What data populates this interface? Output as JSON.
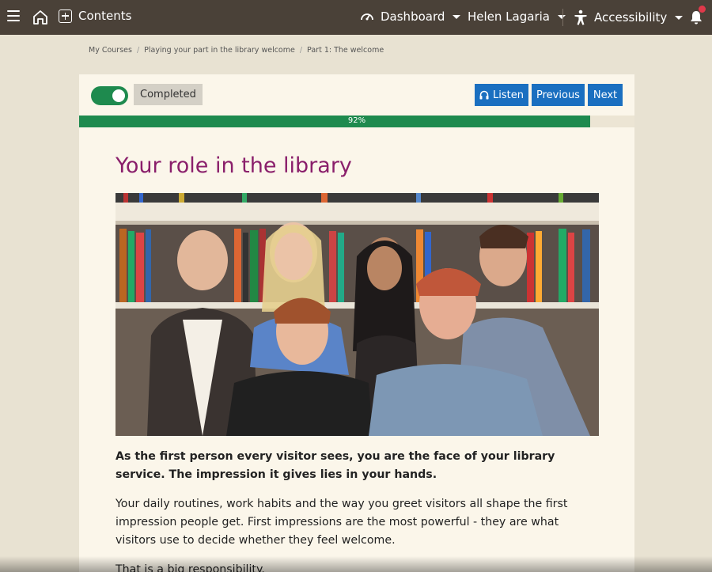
{
  "nav": {
    "contents_label": "Contents",
    "dashboard_label": "Dashboard",
    "user_label": "Helen Lagaria",
    "accessibility_label": "Accessibility"
  },
  "breadcrumb": [
    "My Courses",
    "Playing your part in the library welcome",
    "Part 1: The welcome"
  ],
  "toolbar": {
    "completed_label": "Completed",
    "listen_label": "Listen",
    "previous_label": "Previous",
    "next_label": "Next"
  },
  "progress": {
    "percent": 92,
    "label": "92%"
  },
  "content": {
    "title": "Your role in the library",
    "intro_bold": "As the first person every visitor sees, you are the face of your library service. The impression it gives lies in your hands.",
    "paragraph": "Your daily routines, work habits and the way you greet visitors all shape the first impression people get. First impressions are the most powerful - they are what visitors use to decide whether they feel welcome.",
    "paragraph_cut": "That is a big responsibility."
  },
  "colors": {
    "nav_bg": "#4a4138",
    "accent_green": "#1e8a4e",
    "button_blue": "#1a6fc0",
    "title_purple": "#8a1f6b",
    "page_bg": "#e8e2d2",
    "card_bg": "#fbf6ea"
  }
}
